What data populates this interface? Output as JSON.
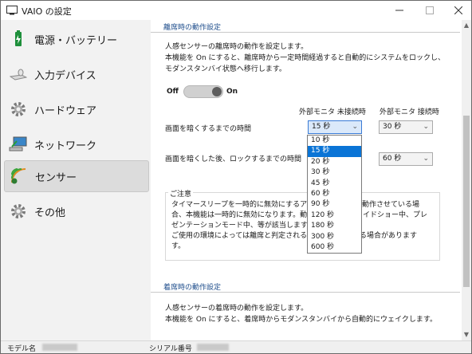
{
  "window": {
    "title": "VAIO の設定"
  },
  "sidebar": {
    "items": [
      {
        "label": "電源・バッテリー",
        "icon": "battery-icon",
        "selected": false
      },
      {
        "label": "入力デバイス",
        "icon": "keyboard-icon",
        "selected": false
      },
      {
        "label": "ハードウェア",
        "icon": "gear-icon",
        "selected": false
      },
      {
        "label": "ネットワーク",
        "icon": "network-icon",
        "selected": false
      },
      {
        "label": "センサー",
        "icon": "sensor-icon",
        "selected": true
      },
      {
        "label": "その他",
        "icon": "gear-icon",
        "selected": false
      }
    ]
  },
  "away": {
    "heading": "離席時の動作設定",
    "desc_line1": "人感センサーの離席時の動作を設定します。",
    "desc_line2": "本機能を On にすると、離席時から一定時間経過すると自動的にシステムをロックし、",
    "desc_line3": "モダンスタンバイ状態へ移行します。",
    "toggle_off": "Off",
    "toggle_on": "On",
    "toggle_state": "on",
    "col_unconnected": "外部モニタ 未接続時",
    "col_connected": "外部モニタ 接続時",
    "row_dim": "画面を暗くするまでの時間",
    "row_lock": "画面を暗くした後、ロックするまでの時間",
    "dim_unconnected": "15 秒",
    "dim_connected": "30 秒",
    "lock_connected": "60 秒",
    "dropdown_options": [
      "10 秒",
      "15 秒",
      "20 秒",
      "30 秒",
      "45 秒",
      "60 秒",
      "90 秒",
      "120 秒",
      "180 秒",
      "300 秒",
      "600 秒"
    ],
    "dropdown_selected_index": 1
  },
  "notice": {
    "title": "ご注意",
    "line1": "タイマースリープを一時的に無効にするア",
    "line1b": "を動作させている場",
    "line2": "合、本機能は一時的に無効になります。動",
    "line2b": "イドショー中、プレ",
    "line3": "ゼンテーションモード中、等が該当します。",
    "line4": "ご使用の環境によっては離席と判定される",
    "line4b": "る場合があります",
    "line5": "す。"
  },
  "presence": {
    "heading": "着席時の動作設定",
    "desc_line1": "人感センサーの着席時の動作を設定します。",
    "desc_line2": "本機能を On にすると、着席時からモダンスタンバイから自動的にウェイクします。"
  },
  "status": {
    "model_label": "モデル名",
    "serial_label": "シリアル番号"
  }
}
